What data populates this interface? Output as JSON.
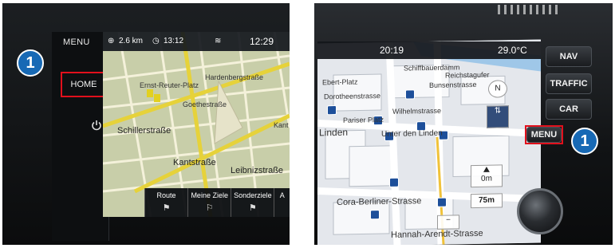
{
  "left_unit": {
    "menu_label": "MENU",
    "home_label": "HOME",
    "callout_number": "1",
    "power_icon": "power-icon",
    "volume_up": "+",
    "volume_down": "−",
    "status": {
      "distance": "2.6 km",
      "clock_small": "13:12",
      "time": "12:29"
    },
    "map_streets": [
      "Ernst-Reuter-Platz",
      "Hardenbergstraße",
      "Goethestraße",
      "Schillerstraße",
      "Kantstraße",
      "Leibnizstraße",
      "Kant"
    ],
    "soft_buttons": [
      {
        "label": "Route",
        "icon": "flag-icon"
      },
      {
        "label": "Meine Ziele",
        "icon": "route-flag-icon"
      },
      {
        "label": "Sonderziele",
        "icon": "poi-flag-icon"
      },
      {
        "label": "A",
        "icon": ""
      }
    ]
  },
  "right_unit": {
    "time": "20:19",
    "temperature": "29.0°C",
    "keys": [
      "NAV",
      "TRAFFIC",
      "CAR",
      "MENU"
    ],
    "callout_number": "1",
    "map_streets": [
      "Schiffbauerdamm",
      "Reichstagufer",
      "Bunsenstrasse",
      "Ebert-Platz",
      "Dorotheenstrasse",
      "Wilhelmstrasse",
      "Pariser Platz",
      "Unter den Linden",
      "Cora-Berliner-Strasse",
      "Hannah-Arendt-Strasse",
      "Linden"
    ],
    "scale": "75m",
    "elevation": "0m",
    "compass": "N"
  }
}
